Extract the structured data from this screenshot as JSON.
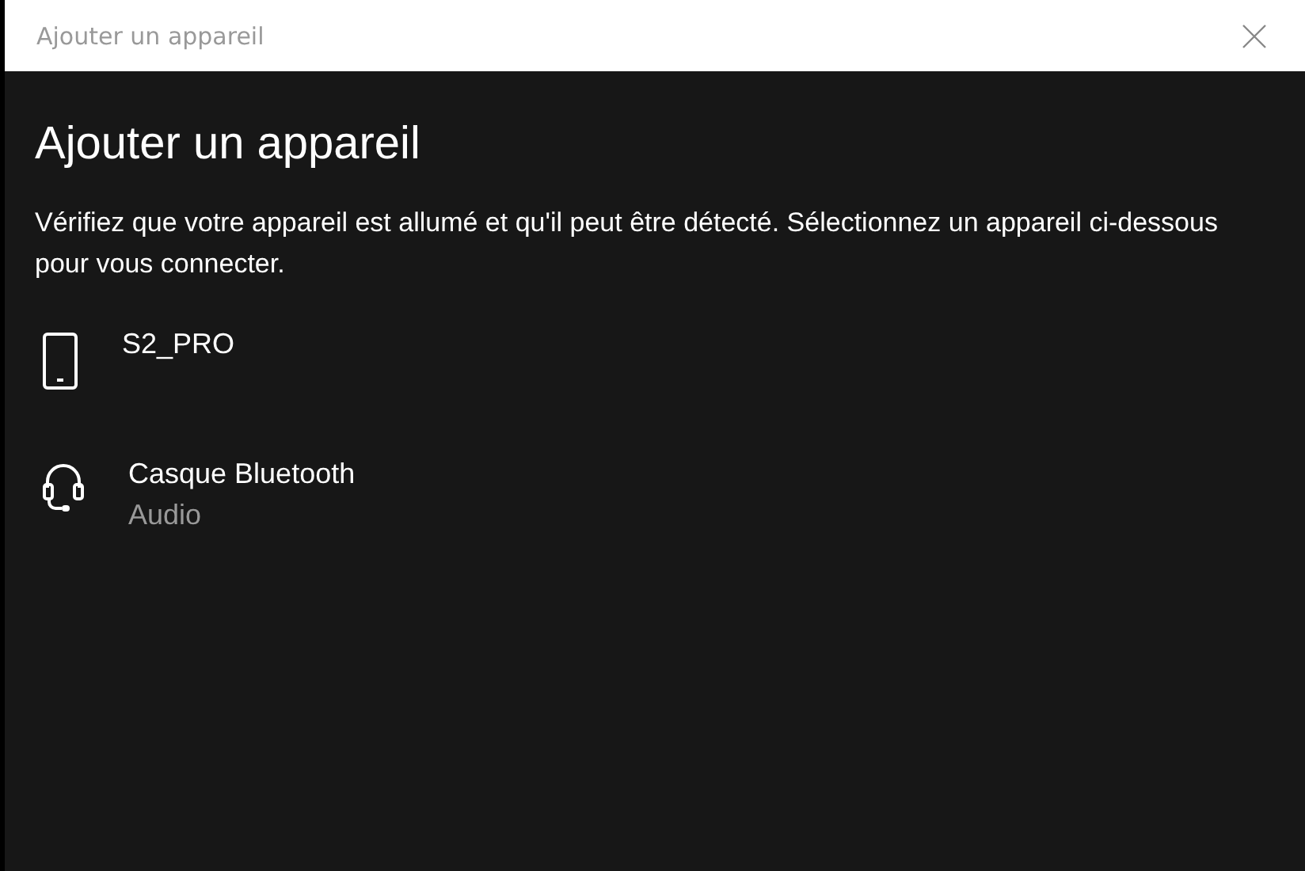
{
  "window": {
    "title": "Ajouter un appareil"
  },
  "heading": "Ajouter un appareil",
  "description": "Vérifiez que votre appareil est allumé et qu'il peut être détecté. Sélectionnez un appareil ci-dessous pour vous connecter.",
  "devices": [
    {
      "kind": "phone",
      "name": "S2_PRO"
    },
    {
      "kind": "headset",
      "name": "Casque Bluetooth",
      "subtitle": "Audio"
    }
  ]
}
